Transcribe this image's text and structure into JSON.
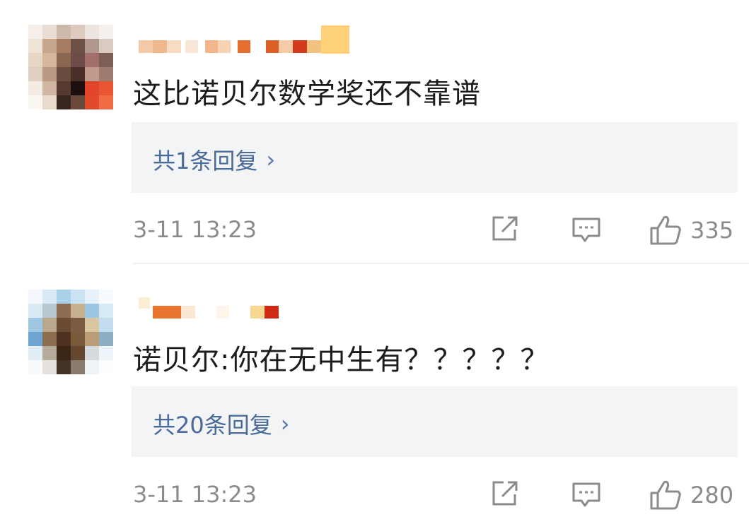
{
  "comments": [
    {
      "text": "这比诺贝尔数学奖还不靠谱",
      "reply_link": "共1条回复",
      "time": "3-11 13:23",
      "likes": "335"
    },
    {
      "text": "诺贝尔:你在无中生有？？？？？",
      "reply_link": "共20条回复",
      "time": "3-11 13:23",
      "likes": "280"
    }
  ],
  "icons": {
    "chevron": "chevron-right-icon",
    "share": "share-edit-icon",
    "comment": "comment-icon",
    "like": "thumb-up-icon"
  },
  "colors": {
    "link": "#4a6a9a",
    "meta": "#8b8b8b",
    "text": "#1c1c1c",
    "reply_bg": "#f3f4f6"
  }
}
